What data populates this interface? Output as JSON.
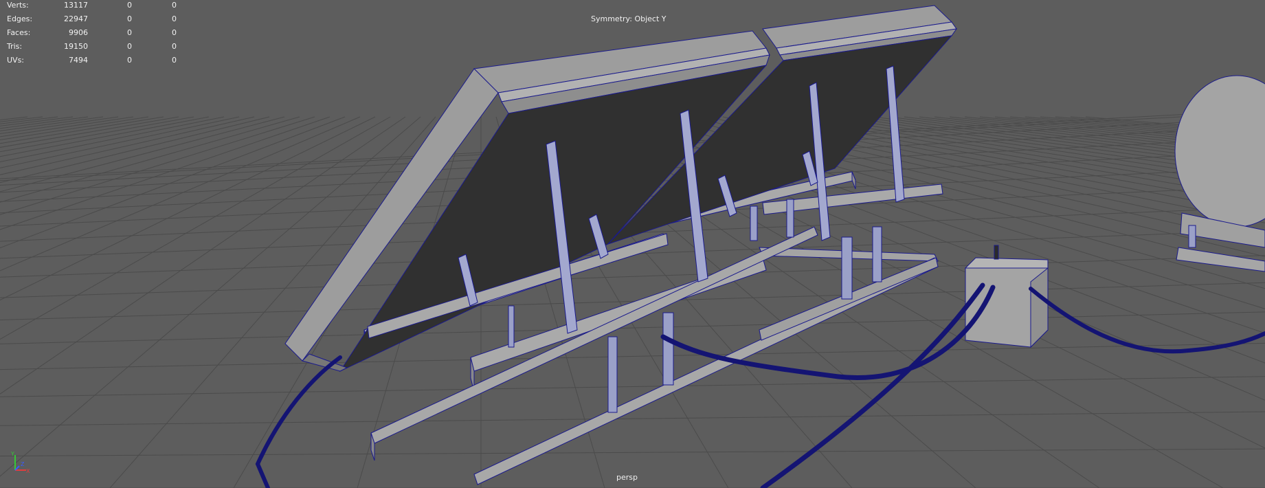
{
  "viewport": {
    "camera": "persp",
    "symmetry": "Symmetry: Object Y"
  },
  "heads_up_display": {
    "rows": [
      {
        "label": "Verts:",
        "values": [
          "13117",
          "0",
          "0"
        ]
      },
      {
        "label": "Edges:",
        "values": [
          "22947",
          "0",
          "0"
        ]
      },
      {
        "label": "Faces:",
        "values": [
          "9906",
          "0",
          "0"
        ]
      },
      {
        "label": "Tris:",
        "values": [
          "19150",
          "0",
          "0"
        ]
      },
      {
        "label": "UVs:",
        "values": [
          "7494",
          "0",
          "0"
        ]
      }
    ]
  },
  "axis_gizmo": {
    "labels": [
      "Y",
      "X",
      "Z"
    ]
  },
  "colors": {
    "background": "#5d5d5d",
    "grid": "#4a4a4a",
    "mesh_face": "#a8a8a8",
    "mesh_face_dark": "#8e8e8e",
    "panel_surface": "#303030",
    "wireframe": "#1a1a8c",
    "cable": "#141473",
    "hud_text": "#f2f2f2"
  }
}
